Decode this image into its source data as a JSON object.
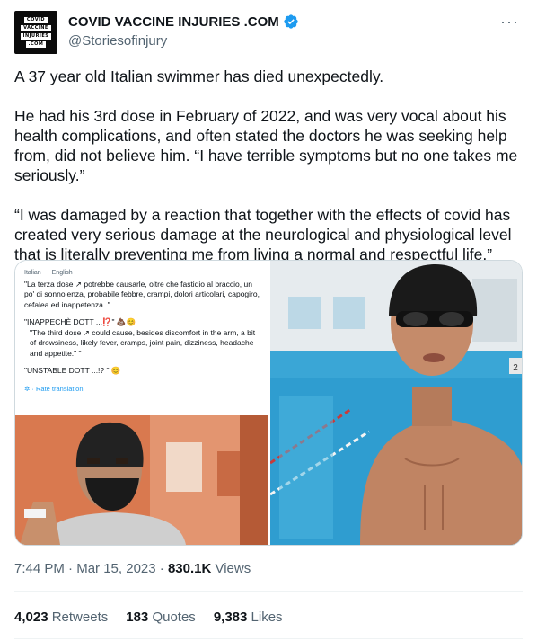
{
  "account": {
    "avatar_lines": [
      "COVID",
      "VACCINE",
      "INJURIES",
      ".COM"
    ],
    "name": "COVID VACCINE INJURIES .COM",
    "handle": "@Storiesofinjury",
    "verified_color": "#1d9bf0"
  },
  "tweet": {
    "paragraphs": [
      "A 37 year old Italian swimmer has died unexpectedly.",
      "He had his 3rd dose in February of 2022, and was very vocal about his health complications, and often stated the doctors he was seeking help from, did not believe him. “I have terrible symptoms but no one takes me seriously.”",
      "“I was damaged by a reaction that together with the effects of covid has created very serious damage at the neurological and physiological level that is literally preventing me from living a normal and respectful life.”"
    ]
  },
  "media": {
    "screenshot": {
      "lang_from": "Italian",
      "lang_to": "English",
      "italian_text": "\"La terza dose ↗ potrebbe causarle, oltre che fastidio al braccio, un po' di sonnolenza, probabile febbre, crampi, dolori articolari, capogiro, cefalea ed inappetenza. \"",
      "italian_caption": "\"INAPPECHÈ DOTT ...⁉️\" 💩😊",
      "english_text": "\"The third dose ↗ could cause, besides discomfort in the arm, a bit of drowsiness, likely fever, cramps, joint pain, dizziness, headache and appetite.\" \"",
      "english_caption": "\"UNSTABLE DOTT ...!?    \"    😊",
      "rate_translation": "Rate translation"
    },
    "pool_lane_number": "2"
  },
  "meta": {
    "time": "7:44 PM",
    "sep1": " · ",
    "date": "Mar 15, 2023",
    "sep2": " · ",
    "views_count": "830.1K",
    "views_label": " Views"
  },
  "stats": {
    "retweets_count": "4,023",
    "retweets_label": " Retweets",
    "quotes_count": "183",
    "quotes_label": " Quotes",
    "likes_count": "9,383",
    "likes_label": " Likes"
  }
}
